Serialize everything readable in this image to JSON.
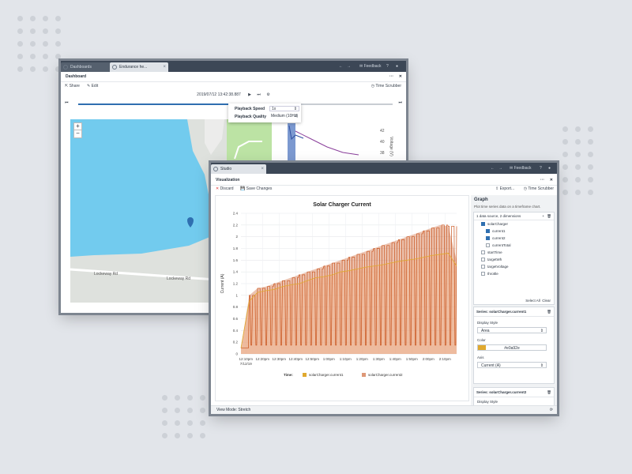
{
  "colors": {
    "background": "#e2e5ea",
    "accent": "#2f6fb0",
    "series1": "#e0a92e",
    "series2": "#c8531c",
    "water": "#72cbee",
    "park": "#bce3a4"
  },
  "back_window": {
    "tabs": [
      {
        "label": "Dashboards"
      },
      {
        "label": "Endurance he..."
      }
    ],
    "feedback": "Feedback",
    "panel_title": "Dashboard",
    "share": "Share",
    "edit": "Edit",
    "time_scrubber": "Time Scrubber",
    "timestamp": "2019/07/12 13:42:38.887",
    "playback": {
      "speed_label": "Playback Speed",
      "speed_value": "1x",
      "quality_label": "Playback Quality",
      "quality_value": "Medium (10Hz)"
    },
    "map": {
      "street1": "Lockeway Rd",
      "street2": "Lockeway Rd"
    },
    "mini_axis": {
      "ticks": [
        "42",
        "40",
        "38",
        "36"
      ],
      "label": "Voltage (V)"
    }
  },
  "front_window": {
    "tab": "Studio",
    "feedback": "Feedback",
    "panel_title": "Visualization",
    "discard": "Discard",
    "save": "Save Changes",
    "export": "Export...",
    "time_scrubber": "Time Scrubber",
    "status": "View Mode: Stretch"
  },
  "chart_data": {
    "type": "area",
    "title": "Solar Charger Current",
    "xlabel": "Time:",
    "ylabel": "Current (A)",
    "ylim": [
      0,
      2.4
    ],
    "yticks": [
      "0",
      "0.2",
      "0.4",
      "0.6",
      "0.8",
      "1",
      "1.2",
      "1.4",
      "1.6",
      "1.8",
      "2",
      "2.2",
      "2.4"
    ],
    "xticks": [
      "12:10pm",
      "12:20pm",
      "12:30pm",
      "12:40pm",
      "12:50pm",
      "1:00pm",
      "1:10pm",
      "1:20pm",
      "1:30pm",
      "1:40pm",
      "1:50pm",
      "2:00pm",
      "2:10pm"
    ],
    "xsub": "7/12/19",
    "grid": true,
    "legend_position": "bottom",
    "series": [
      {
        "name": "solarCharger.current1",
        "color": "#e0a92e",
        "style": "area"
      },
      {
        "name": "solarCharger.current2",
        "color": "#c8531c",
        "style": "area"
      }
    ],
    "envelope": {
      "x": [
        0,
        0.5,
        1,
        1.5,
        2,
        2.5,
        3,
        3.5,
        4,
        4.5,
        5,
        5.5,
        6,
        6.5,
        7,
        7.5,
        8,
        8.5,
        9,
        9.5,
        10,
        10.5,
        11,
        11.5,
        12,
        12.5,
        13
      ],
      "current1": [
        0.1,
        0.9,
        1.05,
        1.08,
        1.1,
        1.15,
        1.18,
        1.2,
        1.25,
        1.3,
        1.32,
        1.35,
        1.4,
        1.42,
        1.45,
        1.48,
        1.5,
        1.52,
        1.55,
        1.58,
        1.6,
        1.62,
        1.65,
        1.68,
        1.7,
        1.72,
        1.5
      ],
      "current2": [
        0.1,
        1.0,
        1.12,
        1.15,
        1.2,
        1.25,
        1.3,
        1.35,
        1.4,
        1.45,
        1.5,
        1.55,
        1.6,
        1.65,
        1.7,
        1.75,
        1.8,
        1.85,
        1.9,
        1.95,
        2.0,
        2.05,
        2.1,
        2.15,
        2.2,
        2.18,
        1.6
      ]
    }
  },
  "sidebar": {
    "title": "Graph",
    "desc": "Plot time series data on a timeframe chart.",
    "datasources": "1 data source, 2 dimensions",
    "tree": [
      {
        "label": "solarCharger",
        "checked": true,
        "indent": 1
      },
      {
        "label": "current1",
        "checked": true,
        "indent": 2
      },
      {
        "label": "current2",
        "checked": true,
        "indent": 2
      },
      {
        "label": "currentTotal",
        "checked": false,
        "indent": 2
      },
      {
        "label": "startTime",
        "checked": false,
        "indent": 1
      },
      {
        "label": "targetWh",
        "checked": false,
        "indent": 1
      },
      {
        "label": "targetVoltage",
        "checked": false,
        "indent": 1
      },
      {
        "label": "throttle",
        "checked": false,
        "indent": 1
      }
    ],
    "select_all": "Select All",
    "clear": "Clear",
    "series1": {
      "title": "Series: solarCharger.current1",
      "display_style_label": "Display Style",
      "display_style": "Area",
      "color_label": "Color",
      "color_value": "#e0a92e",
      "axis_label": "Axis",
      "axis_value": "Current (A)"
    },
    "series2": {
      "title": "Series: solarCharger.current2",
      "display_style_label": "Display Style"
    }
  }
}
